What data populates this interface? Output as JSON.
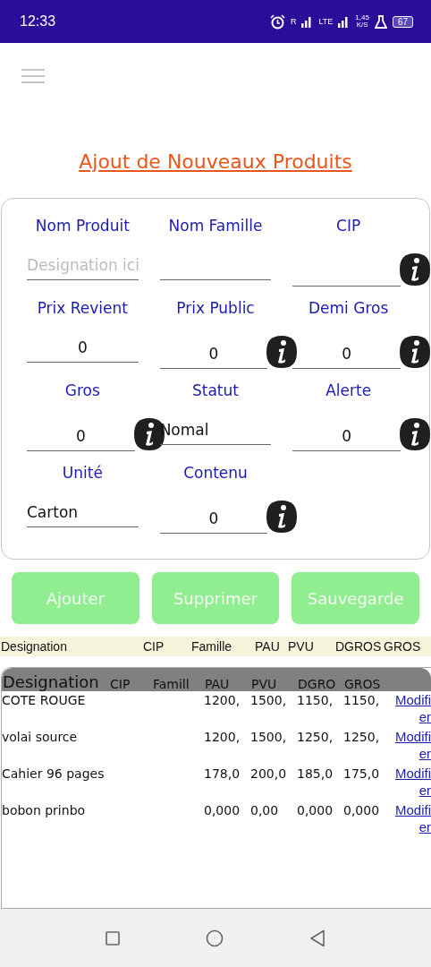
{
  "status_bar": {
    "time": "12:33",
    "signal_labels": [
      "R",
      "LTE"
    ],
    "speed": "1,45",
    "speed_unit": "K/S",
    "battery": "67"
  },
  "title": "Ajout de Nouveaux Produits",
  "fields": [
    {
      "label": "Nom Produit",
      "kind": "text",
      "placeholder": "Designation ici",
      "info": false
    },
    {
      "label": "Nom Famille",
      "kind": "text",
      "info": false
    },
    {
      "label": "CIP",
      "kind": "text",
      "info": true
    },
    {
      "label": "Prix Revient",
      "kind": "number",
      "value": "0",
      "info": false
    },
    {
      "label": "Prix Public",
      "kind": "number",
      "value": "0",
      "info": true
    },
    {
      "label": "Demi Gros",
      "kind": "number",
      "value": "0",
      "info": true
    },
    {
      "label": "Gros",
      "kind": "number",
      "value": "0",
      "info": true
    },
    {
      "label": "Statut",
      "kind": "text",
      "value": "Nomal",
      "info": false
    },
    {
      "label": "Alerte",
      "kind": "number",
      "value": "0",
      "info": true
    },
    {
      "label": "Unité",
      "kind": "text",
      "value": "Carton",
      "info": false
    },
    {
      "label": "Contenu",
      "kind": "number",
      "value": "0",
      "info": true
    }
  ],
  "buttons": [
    {
      "label": "Ajouter",
      "disabled": true
    },
    {
      "label": "Supprimer",
      "disabled": true
    },
    {
      "label": "Sauvegarde",
      "disabled": true
    }
  ],
  "list_header": [
    "Designation",
    "CIP",
    "Famille",
    "PAU",
    "PVU",
    "DGROS",
    "GROS"
  ],
  "table": {
    "columns": [
      "Designation",
      "CIP",
      "Famill",
      "PAU",
      "PVU",
      "DGRO",
      "GROS"
    ],
    "rows": [
      {
        "cells": [
          "COTE ROUGE",
          "",
          "",
          "1200,",
          "1500,",
          "1150,",
          "1150,"
        ],
        "link": "Modifier"
      },
      {
        "cells": [
          "volai source",
          "",
          "",
          "1200,",
          "1500,",
          "1250,",
          "1250,"
        ],
        "link": "Modifier"
      },
      {
        "cells": [
          "Cahier 96 pages",
          "",
          "",
          "178,0",
          "200,0",
          "185,0",
          "175,0"
        ],
        "link": "Modifier"
      },
      {
        "cells": [
          "bobon prinbo",
          "",
          "",
          "0,000",
          "0,00",
          "0,000",
          "0,000"
        ],
        "link": "Modifier"
      }
    ]
  }
}
